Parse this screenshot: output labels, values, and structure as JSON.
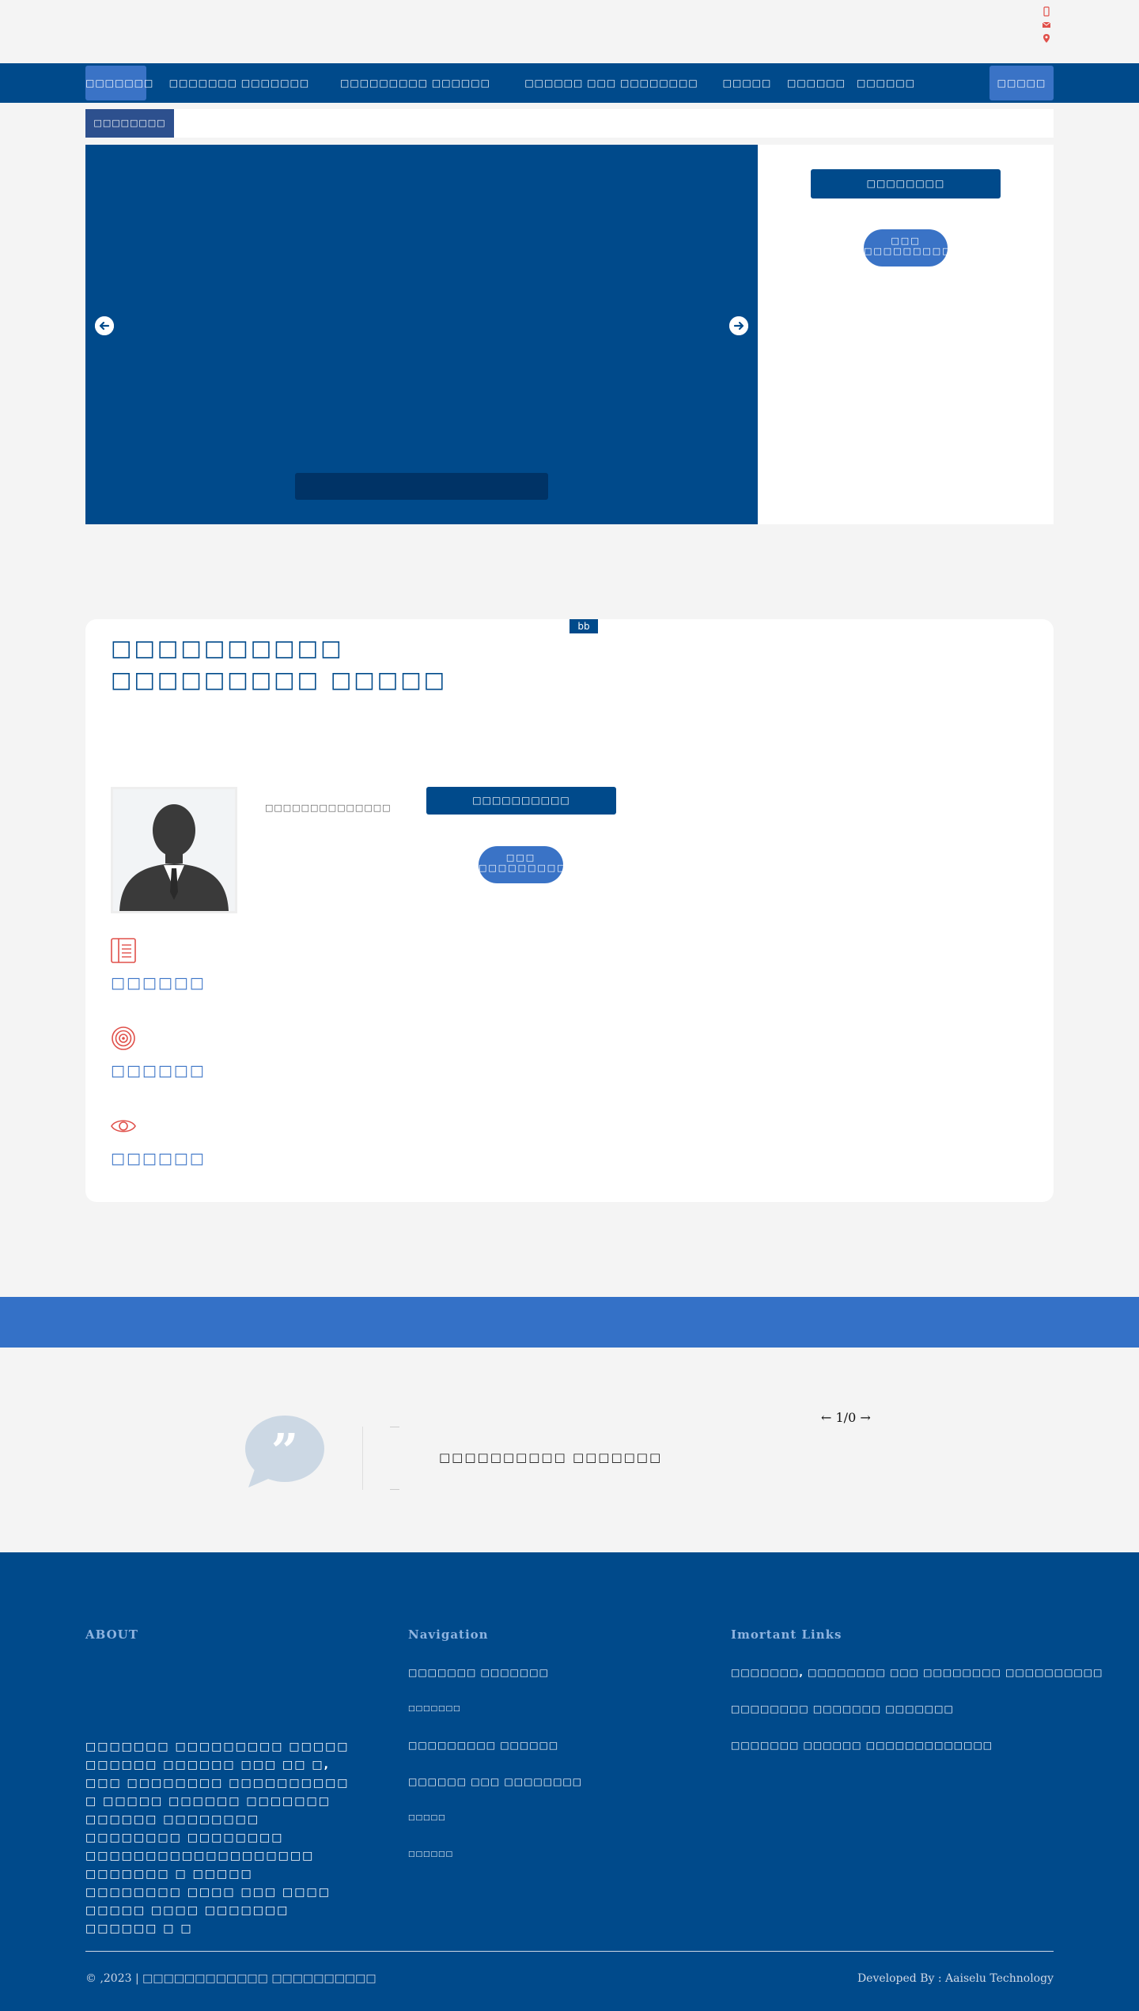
{
  "nav": {
    "items": [
      {
        "label": "□□□□□□□",
        "active": true
      },
      {
        "label": "□□□□□□□ □□□□□□□"
      },
      {
        "label": "□□□□□□□□□ □□□□□□"
      },
      {
        "label": "□□□□□□ □□□ □□□□□□□□"
      },
      {
        "label": "□□□□□"
      },
      {
        "label": "□□□□□□"
      },
      {
        "label": "□□□□□□"
      }
    ],
    "login_label": "□□□□□"
  },
  "notice": {
    "label": "□□□□□□□□"
  },
  "slider": {
    "prev_icon": "arrow-left-icon",
    "next_icon": "arrow-right-icon",
    "caption": ""
  },
  "side_panel": {
    "button_label": "□□□□□□□□",
    "pill_label": "□□□ □□□□□□□□□□"
  },
  "about": {
    "title": "□□□□□□□□□□ □□□□□□□□□ □□□□□",
    "image_alt": "bb",
    "person_name": "□□□□□□□□□□□□□□",
    "button_label": "□□□□□□□□□□",
    "pill_label": "□□□ □□□□□□□□□□",
    "features": [
      {
        "icon": "book-icon",
        "label": "□□□□□□"
      },
      {
        "icon": "target-icon",
        "label": "□□□□□□"
      },
      {
        "icon": "eye-icon",
        "label": "□□□□□□"
      }
    ]
  },
  "testimonial": {
    "icon": "quote-bubble-icon",
    "text": "□□□□□□□□□□ □□□□□□□",
    "pager": "1/0"
  },
  "footer": {
    "about_heading": "ABOUT",
    "about_text": "□□□□□□□ □□□□□□□□□ □□□□□ □□□□□□ □□□□□□ □□□ □□ □, □□□ □□□□□□□□ □□□□□□□□□□ □ □□□□□ □□□□□□ □□□□□□□ □□□□□□ □□□□□□□□ □□□□□□□□ □□□□□□□□ □□□□□□□□□□□□□□□□□□□ □□□□□□□ □ □□□□□ □□□□□□□□ □□□□ □□□ □□□□ □□□□□ □□□□ □□□□□□□ □□□□□□ □ □",
    "nav_heading": "Navigation",
    "nav_links": [
      {
        "label": "□□□□□□□ □□□□□□□",
        "small": false
      },
      {
        "label": "□□□□□□□",
        "small": true
      },
      {
        "label": "□□□□□□□□□ □□□□□□",
        "small": false
      },
      {
        "label": "□□□□□□ □□□ □□□□□□□□",
        "small": false
      },
      {
        "label": "□□□□□",
        "small": true
      },
      {
        "label": "□□□□□□",
        "small": true
      }
    ],
    "links_heading": "Imortant Links",
    "important_links": [
      {
        "label": "□□□□□□□, □□□□□□□□ □□□ □□□□□□□□ □□□□□□□□□□"
      },
      {
        "label": "□□□□□□□□ □□□□□□□ □□□□□□□"
      },
      {
        "label": "□□□□□□□ □□□□□□ □□□□□□□□□□□□□"
      }
    ],
    "copyright": "© ,2023 | □□□□□□□□□□□□ □□□□□□□□□□",
    "developer": "Developed By : Aaiselu Technology"
  },
  "colors": {
    "primary": "#004a8b",
    "accent": "#3a73c6",
    "band": "#3471c7",
    "icon_accent": "#e0504a"
  }
}
